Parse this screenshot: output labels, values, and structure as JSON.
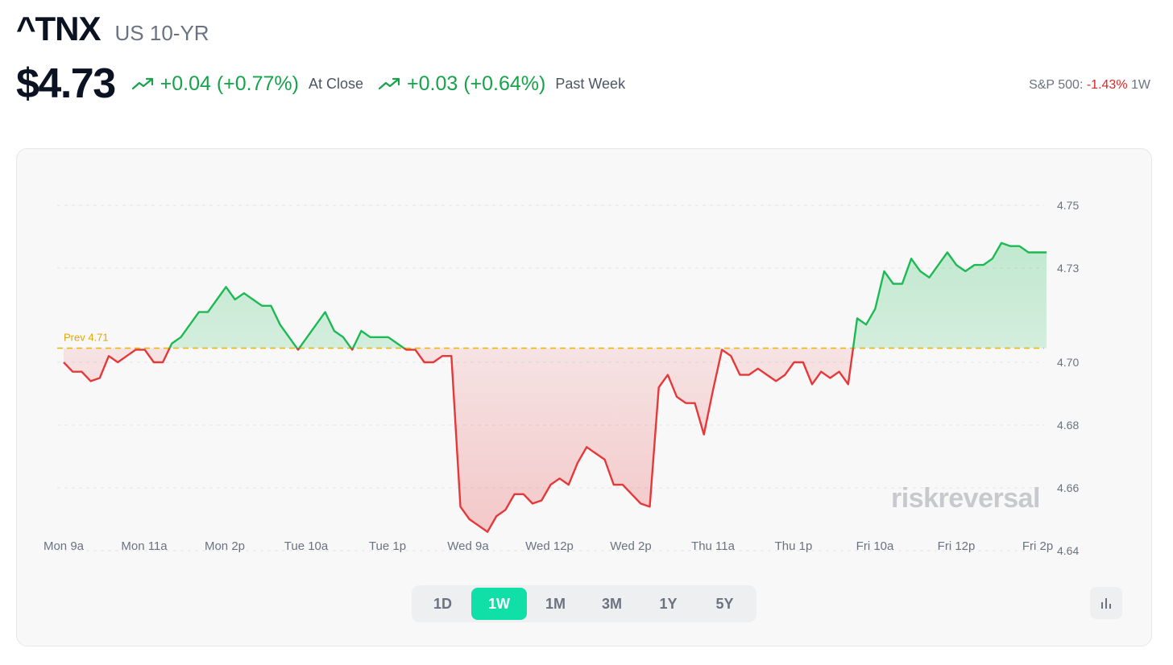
{
  "header": {
    "symbol": "^TNX",
    "name": "US 10-YR",
    "price": "$4.73",
    "change_close": "+0.04 (+0.77%)",
    "change_close_label": "At Close",
    "change_week": "+0.03 (+0.64%)",
    "change_week_label": "Past Week",
    "sp_label": "S&P 500:",
    "sp_value": "-1.43%",
    "sp_period": "1W"
  },
  "ranges": [
    "1D",
    "1W",
    "1M",
    "3M",
    "1Y",
    "5Y"
  ],
  "active_range": "1W",
  "watermark": "riskreversal",
  "colors": {
    "up": "#1db954",
    "down": "#e5383b",
    "prev": "#f5b700",
    "accent": "#10e0a8"
  },
  "icons": {
    "trend": "trending-up-icon",
    "chart_type": "bar-chart-icon"
  },
  "chart_data": {
    "type": "line",
    "title": "",
    "xlabel": "",
    "ylabel": "",
    "ylim": [
      4.64,
      4.75
    ],
    "yticks": [
      "4.75",
      "4.73",
      "4.70",
      "4.68",
      "4.66",
      "4.64"
    ],
    "xticks": [
      "Mon 9a",
      "Mon 11a",
      "Mon 2p",
      "Tue 10a",
      "Tue 1p",
      "Wed 9a",
      "Wed 12p",
      "Wed 2p",
      "Thu 11a",
      "Thu 1p",
      "Fri 10a",
      "Fri 12p",
      "Fri 2p"
    ],
    "reference_line": {
      "label": "Prev 4.71",
      "value": 4.7045
    },
    "grid": true,
    "series": [
      {
        "values": [
          4.7,
          4.697,
          4.697,
          4.694,
          4.695,
          4.702,
          4.7,
          4.702,
          4.704,
          4.704,
          4.7,
          4.7,
          4.706,
          4.708,
          4.712,
          4.716,
          4.716,
          4.72,
          4.724,
          4.72,
          4.722,
          4.72,
          4.718,
          4.718,
          4.712,
          4.708,
          4.704,
          4.708,
          4.712,
          4.716,
          4.71,
          4.708,
          4.704,
          4.71,
          4.708,
          4.708,
          4.708,
          4.706,
          4.704,
          4.704,
          4.7,
          4.7,
          4.702,
          4.702,
          4.654,
          4.65,
          4.648,
          4.646,
          4.651,
          4.653,
          4.658,
          4.658,
          4.655,
          4.656,
          4.661,
          4.663,
          4.661,
          4.668,
          4.673,
          4.671,
          4.669,
          4.661,
          4.661,
          4.658,
          4.655,
          4.654,
          4.692,
          4.696,
          4.689,
          4.687,
          4.687,
          4.677,
          4.691,
          4.704,
          4.702,
          4.696,
          4.696,
          4.698,
          4.696,
          4.694,
          4.696,
          4.7,
          4.7,
          4.693,
          4.697,
          4.695,
          4.697,
          4.693,
          4.714,
          4.712,
          4.717,
          4.729,
          4.725,
          4.725,
          4.733,
          4.729,
          4.727,
          4.731,
          4.735,
          4.731,
          4.729,
          4.731,
          4.731,
          4.733,
          4.738,
          4.737,
          4.737,
          4.735,
          4.735,
          4.735
        ]
      }
    ]
  }
}
